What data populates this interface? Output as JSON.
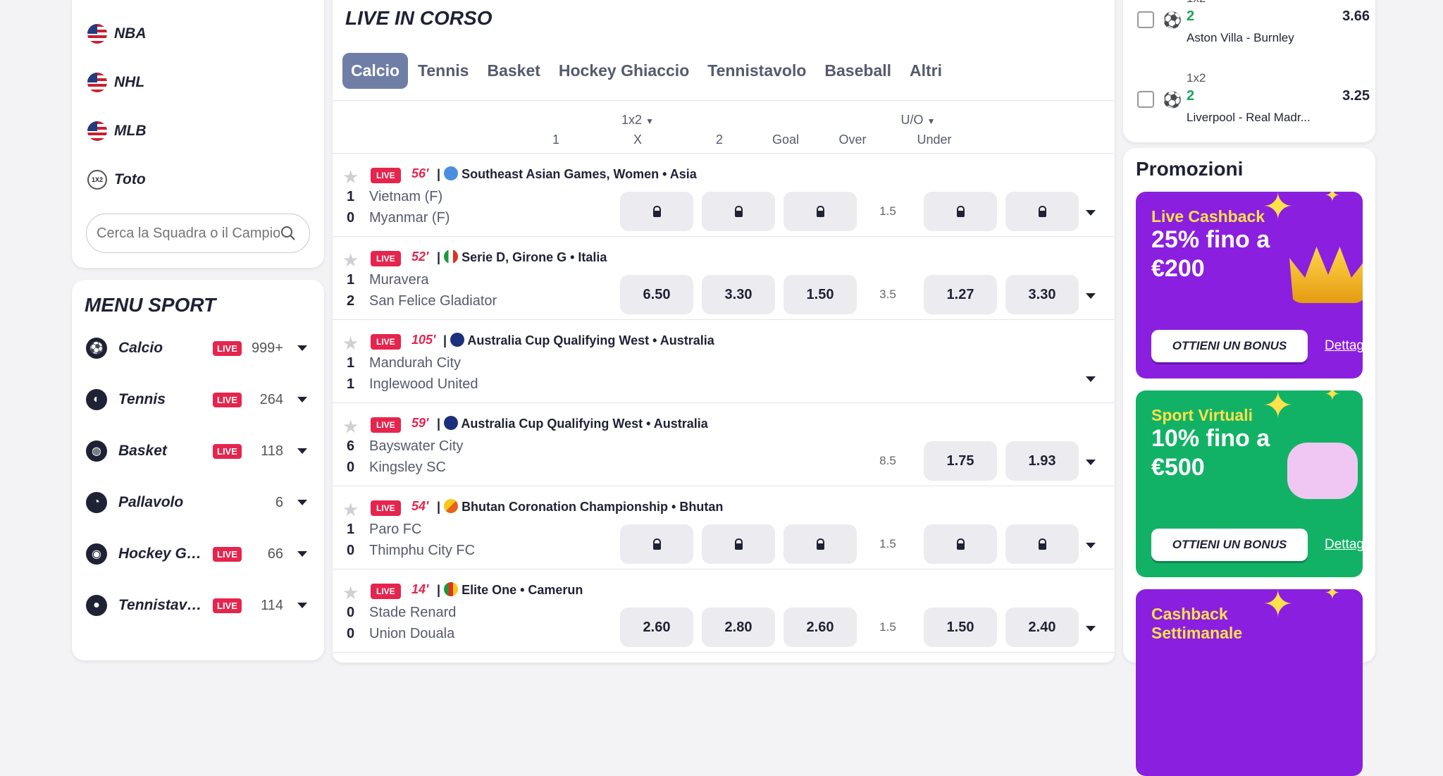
{
  "leagues": [
    {
      "label": "NBA",
      "icon": "us-flag-icon"
    },
    {
      "label": "NHL",
      "icon": "us-flag-icon"
    },
    {
      "label": "MLB",
      "icon": "us-flag-icon"
    },
    {
      "label": "Toto",
      "icon": "toto-1x2-icon"
    }
  ],
  "search": {
    "placeholder": "Cerca la Squadra o il Campionato"
  },
  "menu": {
    "title": "MENU SPORT",
    "live_label": "LIVE",
    "items": [
      {
        "label": "Calcio",
        "count": "999+",
        "live": true,
        "icon": "soccer-ball-icon"
      },
      {
        "label": "Tennis",
        "count": "264",
        "live": true,
        "icon": "tennis-ball-icon"
      },
      {
        "label": "Basket",
        "count": "118",
        "live": true,
        "icon": "basketball-icon"
      },
      {
        "label": "Pallavolo",
        "count": "6",
        "live": false,
        "icon": "volleyball-icon"
      },
      {
        "label": "Hockey Ghiaccio",
        "count": "66",
        "live": true,
        "icon": "hockey-puck-icon"
      },
      {
        "label": "Tennistavolo",
        "count": "114",
        "live": true,
        "icon": "table-tennis-icon"
      }
    ]
  },
  "main": {
    "title": "LIVE IN CORSO",
    "tabs": [
      "Calcio",
      "Tennis",
      "Basket",
      "Hockey Ghiaccio",
      "Tennistavolo",
      "Baseball",
      "Altri"
    ],
    "headers": {
      "market1": "1x2",
      "market2": "U/O",
      "c1": "1",
      "cx": "X",
      "c2": "2",
      "goal": "Goal",
      "over": "Over",
      "under": "Under"
    },
    "live_label": "LIVE",
    "events": [
      {
        "minute": "56'",
        "competition": "Southeast Asian Games, Women",
        "region": "Asia",
        "flag": "globe-icon",
        "home": "Vietnam (F)",
        "away": "Myanmar (F)",
        "score_home": "1",
        "score_away": "0",
        "odds": [
          "lock",
          "lock",
          "lock"
        ],
        "goal": "1.5",
        "ou": [
          "lock",
          "lock"
        ]
      },
      {
        "minute": "52'",
        "competition": "Serie D, Girone G",
        "region": "Italia",
        "flag": "italy-flag-icon",
        "home": "Muravera",
        "away": "San Felice Gladiator",
        "score_home": "1",
        "score_away": "2",
        "odds": [
          "6.50",
          "3.30",
          "1.50"
        ],
        "goal": "3.5",
        "ou": [
          "1.27",
          "3.30"
        ]
      },
      {
        "minute": "105'",
        "competition": "Australia Cup Qualifying West",
        "region": "Australia",
        "flag": "australia-flag-icon",
        "home": "Mandurah City",
        "away": "Inglewood United",
        "score_home": "1",
        "score_away": "1",
        "odds": [],
        "goal": "",
        "ou": []
      },
      {
        "minute": "59'",
        "competition": "Australia Cup Qualifying West",
        "region": "Australia",
        "flag": "australia-flag-icon",
        "home": "Bayswater City",
        "away": "Kingsley SC",
        "score_home": "6",
        "score_away": "0",
        "odds": [],
        "goal": "8.5",
        "ou": [
          "1.75",
          "1.93"
        ]
      },
      {
        "minute": "54'",
        "competition": "Bhutan Coronation Championship",
        "region": "Bhutan",
        "flag": "bhutan-flag-icon",
        "home": "Paro FC",
        "away": "Thimphu City FC",
        "score_home": "1",
        "score_away": "0",
        "odds": [
          "lock",
          "lock",
          "lock"
        ],
        "goal": "1.5",
        "ou": [
          "lock",
          "lock"
        ]
      },
      {
        "minute": "14'",
        "competition": "Elite One",
        "region": "Camerun",
        "flag": "cameroon-flag-icon",
        "home": "Stade Renard",
        "away": "Union Douala",
        "score_home": "0",
        "score_away": "0",
        "odds": [
          "2.60",
          "2.80",
          "2.60"
        ],
        "goal": "1.5",
        "ou": [
          "1.50",
          "2.40"
        ]
      }
    ]
  },
  "betslip": [
    {
      "market": "1x2",
      "selection": "2",
      "odd": "3.66",
      "match": "Aston Villa  -  Burnley"
    },
    {
      "market": "1x2",
      "selection": "2",
      "odd": "3.25",
      "match": "Liverpool  -  Real Madr..."
    }
  ],
  "promos": {
    "title": "Promozioni",
    "items": [
      {
        "title": "Live Cashback",
        "headline": "25% fino a €200",
        "button": "OTTIENI UN BONUS",
        "details": "Dettagli",
        "color": "#8a1fe0"
      },
      {
        "title": "Sport Virtuali",
        "headline": "10% fino a €500",
        "button": "OTTIENI UN BONUS",
        "details": "Dettagli",
        "color": "#12b266"
      },
      {
        "title": "Cashback Settimanale",
        "headline": "",
        "button": "",
        "details": "",
        "color": "#8a1fe0"
      }
    ]
  },
  "colors": {
    "accent": "#e5254d",
    "tab_active": "#6f7ea6",
    "green": "#1aa35a"
  }
}
